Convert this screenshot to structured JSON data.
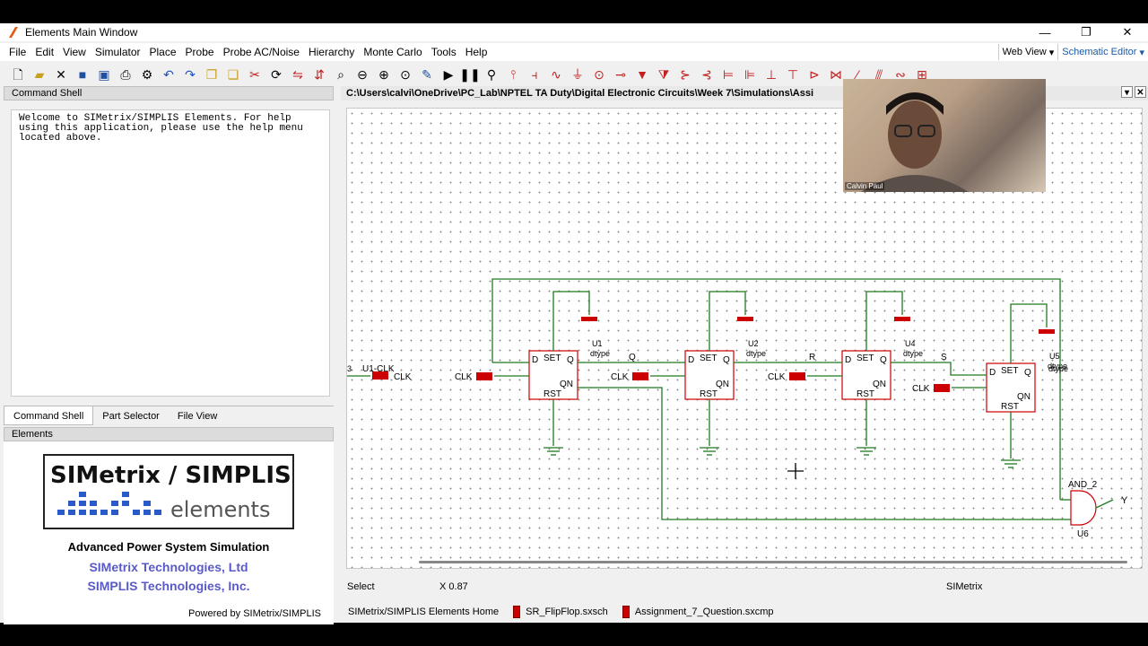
{
  "window": {
    "title": "Elements Main Window",
    "minimize": "—",
    "restore": "❐",
    "close": "✕"
  },
  "menu": [
    "File",
    "Edit",
    "View",
    "Simulator",
    "Place",
    "Probe",
    "Probe AC/Noise",
    "Hierarchy",
    "Monte Carlo",
    "Tools",
    "Help"
  ],
  "view_selector": {
    "web_view": "Web View",
    "schematic_editor": "Schematic Editor"
  },
  "toolbar_icons": [
    "new-file-icon",
    "open-folder-icon",
    "close-icon",
    "save-icon",
    "save-all-icon",
    "print-icon",
    "settings-icon",
    "undo-icon",
    "redo-icon",
    "copy-icon",
    "paste-icon",
    "cut-icon",
    "rotate-icon",
    "flip-icon",
    "zoom-fit-icon",
    "zoom-out-icon",
    "zoom-in-icon",
    "zoom-area-icon",
    "pencil-icon",
    "run-icon",
    "pause-icon",
    "binoculars-icon"
  ],
  "command_shell": {
    "header": "Command Shell",
    "text": "Welcome to SIMetrix/SIMPLIS Elements. For help\nusing this application, please use the help menu\nlocated above."
  },
  "left_tabs": [
    "Command Shell",
    "Part Selector",
    "File View"
  ],
  "elements_panel": {
    "header": "Elements",
    "logo_top": "SIMetrix / SIMPLIS",
    "logo_bottom": "elements",
    "tagline": "Advanced Power System Simulation",
    "company1": "SIMetrix Technologies, Ltd",
    "company2": "SIMPLIS Technologies, Inc.",
    "powered": "Powered by SIMetrix/SIMPLIS"
  },
  "schematic_path": "C:\\Users\\calvi\\OneDrive\\PC_Lab\\NPTEL TA Duty\\Digital Electronic Circuits\\Week 7\\Simulations\\Assi",
  "schematic": {
    "flipflops": [
      {
        "ref": "U1",
        "type": "dtype",
        "out": "Q"
      },
      {
        "ref": "U2",
        "type": "dtype",
        "out": "R"
      },
      {
        "ref": "U4",
        "type": "dtype",
        "out": "S"
      },
      {
        "ref": "U5",
        "type": "dtype",
        "out": ""
      }
    ],
    "pins": {
      "d": "D",
      "set": "SET",
      "q": "Q",
      "qn": "QN",
      "rst": "RST"
    },
    "clk_label": "CLK",
    "input_label": "U1-CLK",
    "input_pin_num": "3",
    "and_gate": {
      "name": "AND_2",
      "ref": "U6",
      "out": "Y"
    }
  },
  "status": {
    "mode": "Select",
    "coord": "X 0.87",
    "app": "SIMetrix"
  },
  "doc_tabs": [
    "SIMetrix/SIMPLIS Elements Home",
    "SR_FlipFlop.sxsch",
    "Assignment_7_Question.sxcmp"
  ],
  "webcam": {
    "name": "Calvin Paul"
  },
  "colors": {
    "wire": "#1f7a1f",
    "component": "#cc0000",
    "accent": "#1a5aa8",
    "company": "#5a5ac8"
  }
}
